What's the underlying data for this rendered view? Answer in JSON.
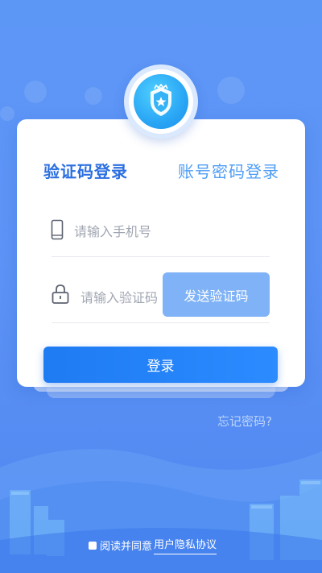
{
  "tabs": {
    "sms_login": "验证码登录",
    "password_login": "账号密码登录"
  },
  "phone": {
    "placeholder": "请输入手机号",
    "value": ""
  },
  "code": {
    "placeholder": "请输入验证码",
    "value": ""
  },
  "send_code_label": "发送验证码",
  "login_label": "登录",
  "forgot_label": "忘记密码?",
  "agreement": {
    "prefix": "阅读并同意",
    "link": "用户隐私协议"
  },
  "colors": {
    "primary": "#1f7bf2",
    "active_tab": "#2c6fe0",
    "inactive_tab": "#4f9df5",
    "send_button": "#7fb2f6"
  },
  "icons": [
    "police-shield-icon",
    "phone-icon",
    "lock-icon"
  ]
}
